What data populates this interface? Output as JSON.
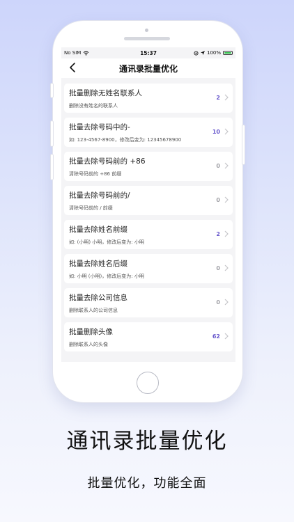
{
  "status_bar": {
    "carrier": "No SIM",
    "time": "15:37",
    "battery": "100%"
  },
  "navbar": {
    "title": "通讯录批量优化"
  },
  "items": [
    {
      "title": "批量删除无姓名联系人",
      "subtitle": "删除没有姓名的联系人",
      "count": "2",
      "active": true
    },
    {
      "title": "批量去除号码中的-",
      "subtitle": "如: 123-4567-8900，修改后变为: 12345678900",
      "count": "10",
      "active": true
    },
    {
      "title": "批量去除号码前的 +86",
      "subtitle": "清除号码前的 +86 前缀",
      "count": "0",
      "active": false
    },
    {
      "title": "批量去除号码前的/",
      "subtitle": "清除号码前的 / 前缀",
      "count": "0",
      "active": false
    },
    {
      "title": "批量去除姓名前缀",
      "subtitle": "如: (小明) 小明，修改后变为: 小明",
      "count": "2",
      "active": true
    },
    {
      "title": "批量去除姓名后缀",
      "subtitle": "如: 小明 (小明)，修改后变为: 小明",
      "count": "0",
      "active": false
    },
    {
      "title": "批量去除公司信息",
      "subtitle": "删除联系人的公司信息",
      "count": "0",
      "active": false
    },
    {
      "title": "批量删除头像",
      "subtitle": "删除联系人的头像",
      "count": "62",
      "active": true
    }
  ],
  "promo": {
    "headline": "通讯录批量优化",
    "subline": "批量优化，功能全面"
  },
  "colors": {
    "accent_count": "#6a5acd",
    "muted_count": "#a0a0a6",
    "chevron": "#c4c4c8"
  }
}
